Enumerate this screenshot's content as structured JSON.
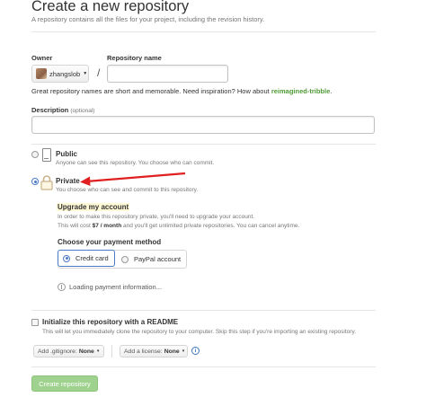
{
  "header": {
    "title": "Create a new repository",
    "subtitle": "A repository contains all the files for your project, including the revision history."
  },
  "owner": {
    "label": "Owner",
    "value": "zhangslob",
    "caret": "▼"
  },
  "slash": "/",
  "repo_name": {
    "label": "Repository name",
    "value": ""
  },
  "hint": {
    "text": "Great repository names are short and memorable. Need inspiration? How about ",
    "suggestion": "reimagined-tribble",
    "end": "."
  },
  "description": {
    "label": "Description",
    "optional": "(optional)",
    "value": ""
  },
  "visibility": {
    "public": {
      "label": "Public",
      "description": "Anyone can see this repository. You choose who can commit."
    },
    "private": {
      "label": "Private",
      "description": "You choose who can see and commit to this repository."
    },
    "selected": "private"
  },
  "upgrade": {
    "title": "Upgrade my account",
    "line1": "In order to make this repository private, you'll need to upgrade your account.",
    "line2_pre": "This will cost ",
    "line2_price": "$7 / month",
    "line2_post": " and you'll get unlimited private repositories. You can cancel anytime."
  },
  "payment": {
    "title": "Choose your payment method",
    "options": [
      {
        "label": "Credit card",
        "selected": true
      },
      {
        "label": "PayPal account",
        "selected": false
      }
    ],
    "loading": "Loading payment information..."
  },
  "readme": {
    "label": "Initialize this repository with a README",
    "description": "This will let you immediately clone the repository to your computer. Skip this step if you're importing an existing repository.",
    "checked": false
  },
  "gitignore": {
    "label": "Add .gitignore:",
    "value": "None",
    "caret": "▾"
  },
  "license": {
    "label": "Add a license:",
    "value": "None",
    "caret": "▾"
  },
  "info_icon": "i",
  "create_button": "Create repository",
  "colors": {
    "accent_blue": "#4a79c5",
    "suggestion_green": "#4e9a34",
    "create_button_bg": "#9fd28f",
    "annotation_arrow": "#e02020",
    "upgrade_highlight": "#fff9d6"
  },
  "icons": {
    "public": "repo-book-icon",
    "private": "lock-icon",
    "loading": "spinner-icon",
    "info": "info-icon"
  }
}
